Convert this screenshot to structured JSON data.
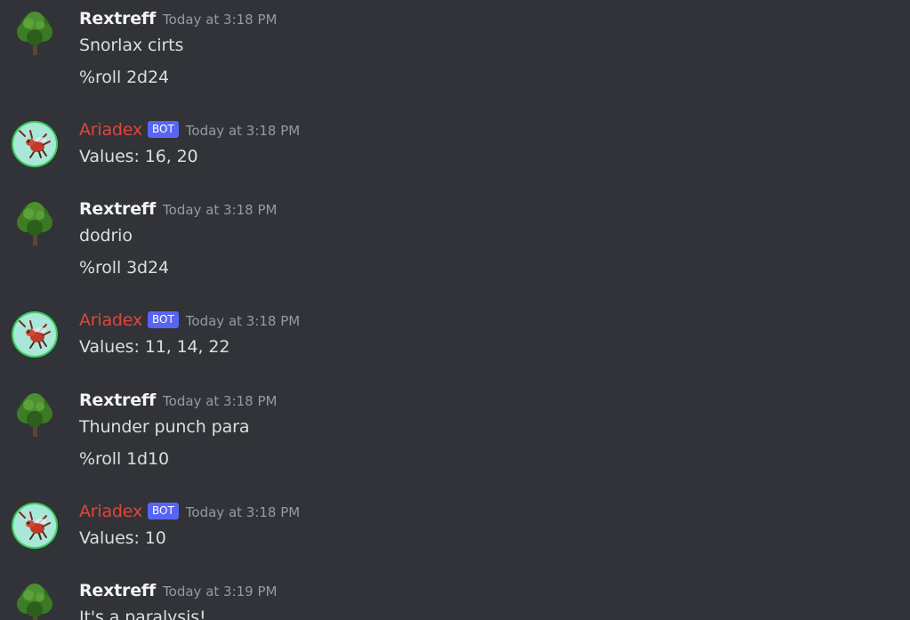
{
  "messages": [
    {
      "author": "Rextreff",
      "is_bot": false,
      "avatar": "tree-avatar-icon",
      "timestamp": "Today at 3:18 PM",
      "lines": [
        "Snorlax cirts",
        "%roll 2d24"
      ]
    },
    {
      "author": "Ariadex",
      "is_bot": true,
      "bot_tag": "BOT",
      "avatar": "pokemon-sprite-avatar-icon",
      "timestamp": "Today at 3:18 PM",
      "lines": [
        "Values: 16, 20"
      ]
    },
    {
      "author": "Rextreff",
      "is_bot": false,
      "avatar": "tree-avatar-icon",
      "timestamp": "Today at 3:18 PM",
      "lines": [
        "dodrio",
        "%roll 3d24"
      ]
    },
    {
      "author": "Ariadex",
      "is_bot": true,
      "bot_tag": "BOT",
      "avatar": "pokemon-sprite-avatar-icon",
      "timestamp": "Today at 3:18 PM",
      "lines": [
        "Values: 11, 14, 22"
      ]
    },
    {
      "author": "Rextreff",
      "is_bot": false,
      "avatar": "tree-avatar-icon",
      "timestamp": "Today at 3:18 PM",
      "lines": [
        "Thunder punch para",
        "%roll 1d10"
      ]
    },
    {
      "author": "Ariadex",
      "is_bot": true,
      "bot_tag": "BOT",
      "avatar": "pokemon-sprite-avatar-icon",
      "timestamp": "Today at 3:18 PM",
      "lines": [
        "Values: 10"
      ]
    },
    {
      "author": "Rextreff",
      "is_bot": false,
      "avatar": "tree-avatar-icon",
      "timestamp": "Today at 3:19 PM",
      "lines": [
        "It's a paralysis!"
      ]
    }
  ],
  "colors": {
    "background": "#313338",
    "username": "#f2f3f5",
    "bot_username": "#e0463a",
    "bot_tag": "#5865f2",
    "timestamp": "#949ba4",
    "message_text": "#dbdee1",
    "bot_avatar_bg": "#a9e8d8",
    "bot_avatar_ring": "#3ccc5c"
  }
}
